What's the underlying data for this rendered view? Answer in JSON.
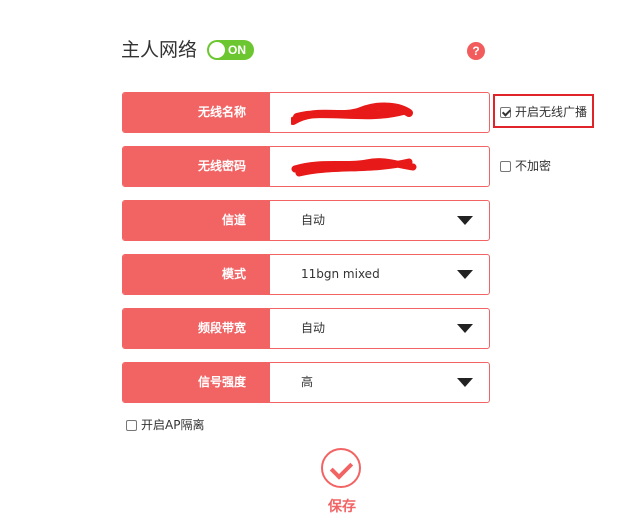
{
  "header": {
    "title": "主人网络",
    "toggle_label": "ON",
    "help_label": "?"
  },
  "fields": [
    {
      "label": "无线名称",
      "value": ""
    },
    {
      "label": "无线密码",
      "value": ""
    },
    {
      "label": "信道",
      "value": "自动"
    },
    {
      "label": "模式",
      "value": "11bgn mixed"
    },
    {
      "label": "频段带宽",
      "value": "自动"
    },
    {
      "label": "信号强度",
      "value": "高"
    }
  ],
  "options": {
    "broadcast": {
      "label": "开启无线广播",
      "checked": true
    },
    "no_encrypt": {
      "label": "不加密",
      "checked": false
    },
    "ap_isolation": {
      "label": "开启AP隔离",
      "checked": false
    }
  },
  "save_label": "保存",
  "colors": {
    "accent": "#f26364",
    "toggle_on": "#6cc62f",
    "highlight": "#e0242a",
    "redaction": "#e81919"
  }
}
